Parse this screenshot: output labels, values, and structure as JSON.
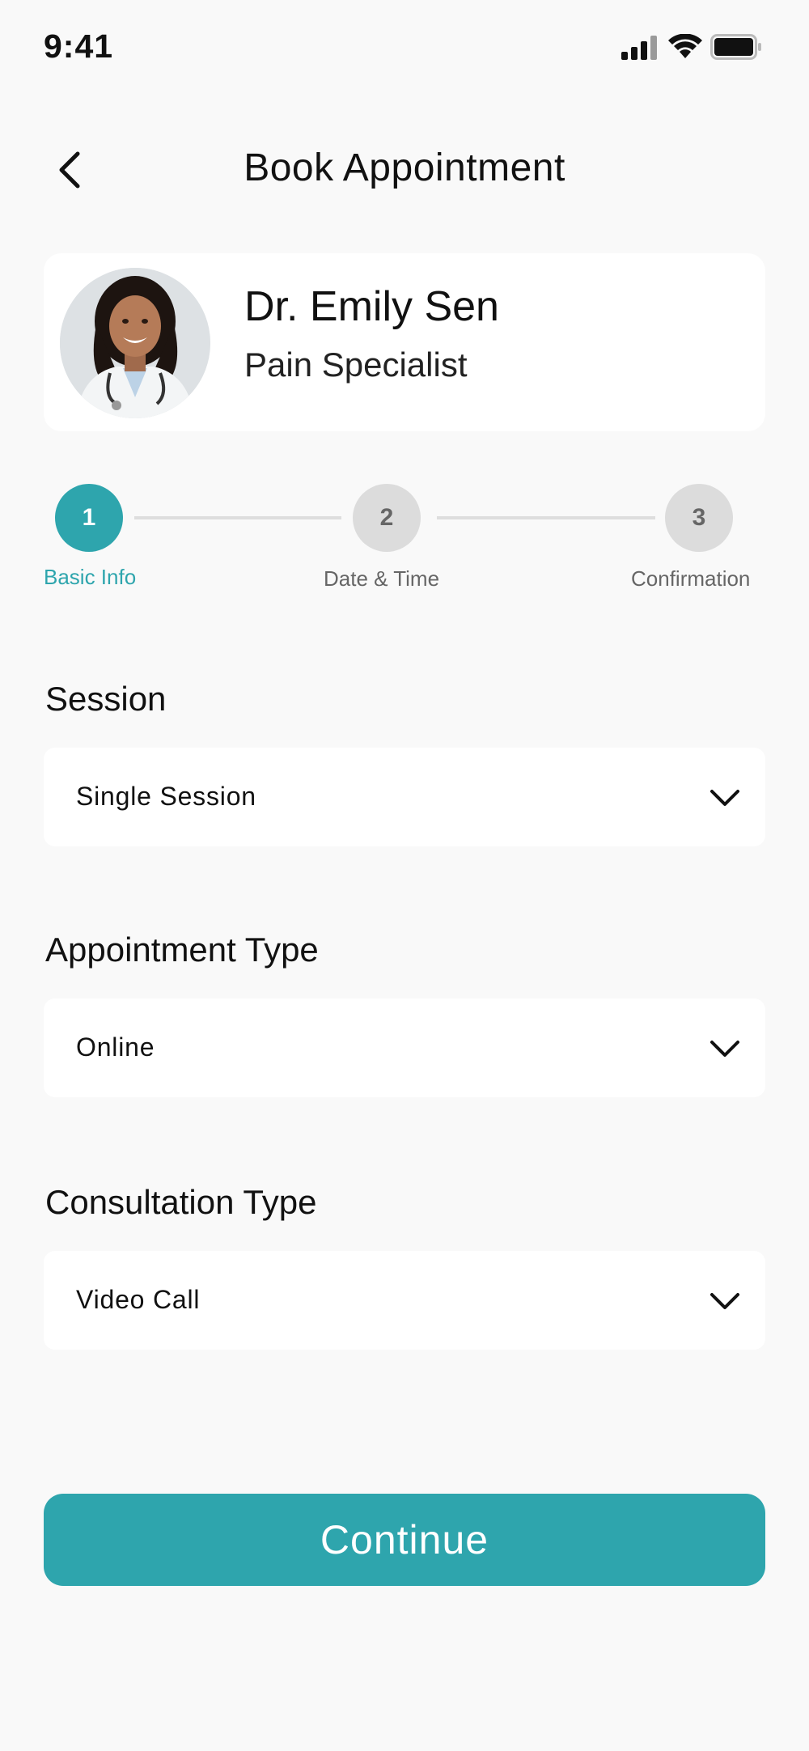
{
  "status_bar": {
    "time": "9:41",
    "icons": [
      "signal-icon",
      "wifi-icon",
      "battery-icon"
    ]
  },
  "header": {
    "title": "Book Appointment",
    "back_icon": "chevron-left-icon"
  },
  "doctor": {
    "name": "Dr. Emily Sen",
    "specialty": "Pain Specialist"
  },
  "stepper": {
    "steps": [
      {
        "number": "1",
        "label": "Basic Info",
        "active": true
      },
      {
        "number": "2",
        "label": "Date & Time",
        "active": false
      },
      {
        "number": "3",
        "label": "Confirmation",
        "active": false
      }
    ]
  },
  "form": {
    "session": {
      "label": "Session",
      "value": "Single Session"
    },
    "appointment_type": {
      "label": "Appointment Type",
      "value": "Online"
    },
    "consultation_type": {
      "label": "Consultation Type",
      "value": "Video Call"
    }
  },
  "actions": {
    "continue_label": "Continue"
  },
  "colors": {
    "accent": "#2ea5ad",
    "background": "#f9f9f9",
    "card": "#ffffff",
    "inactive_step": "#dcdcdc"
  }
}
